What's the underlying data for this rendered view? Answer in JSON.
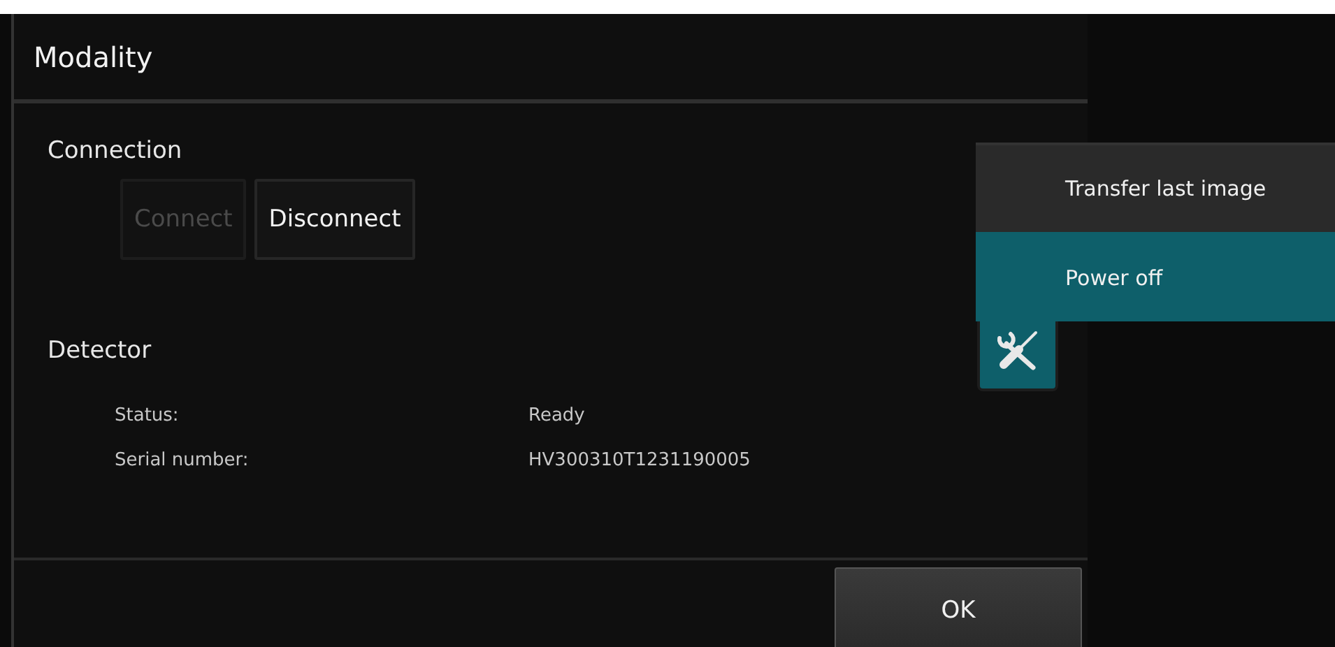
{
  "window": {
    "title": "Modality"
  },
  "connection": {
    "heading": "Connection",
    "buttons": [
      {
        "label": "Connect",
        "disabled": true
      },
      {
        "label": "Disconnect",
        "disabled": false
      }
    ]
  },
  "detector": {
    "heading": "Detector",
    "fields": [
      {
        "label": "Status:",
        "value": "Ready"
      },
      {
        "label": "Serial number:",
        "value": "HV300310T1231190005"
      }
    ]
  },
  "menu": {
    "items": [
      {
        "label": "Transfer last image",
        "selected": false
      },
      {
        "label": "Power off",
        "selected": true
      }
    ]
  },
  "footer": {
    "ok": "OK"
  }
}
